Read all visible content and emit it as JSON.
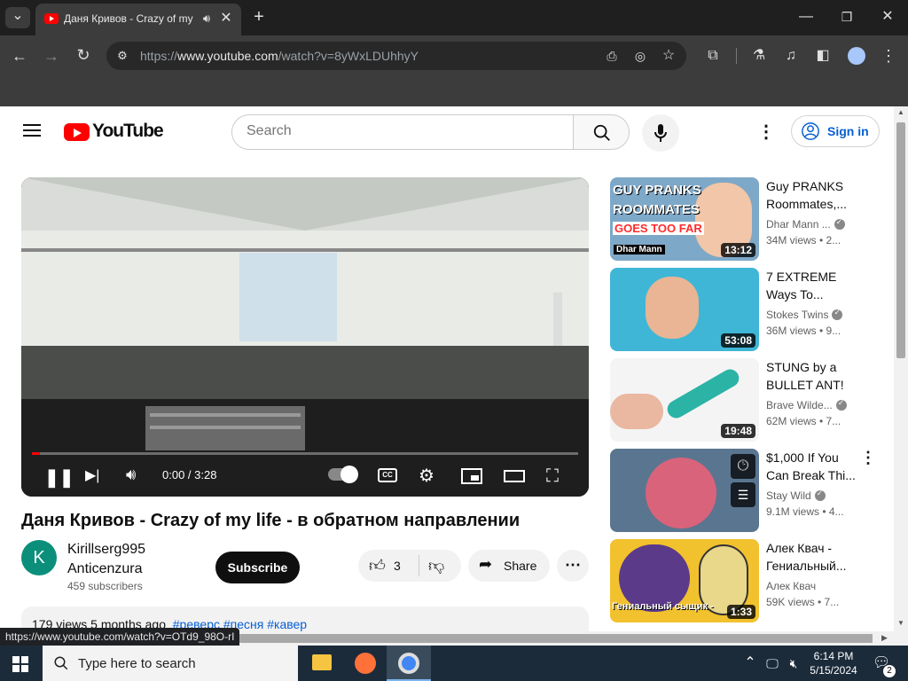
{
  "browser": {
    "tab_title": "Даня Кривов - Crazy of my",
    "url_prefix": "https://",
    "url_host": "www.youtube.com",
    "url_path": "/watch?v=8yWxLDUhhyY",
    "status_url": "https://www.youtube.com/watch?v=OTd9_98O-rI"
  },
  "header": {
    "logo_text": "YouTube",
    "search_placeholder": "Search",
    "sign_in": "Sign in"
  },
  "player": {
    "time": "0:00 / 3:28",
    "progress_fraction": 0.0
  },
  "video": {
    "title": "Даня Кривов - Crazy of my life - в обратном направлении",
    "channel_line1": "Kirillserg995",
    "channel_line2": "Anticenzura",
    "avatar_letter": "K",
    "subscribers": "459 subscribers",
    "subscribe_label": "Subscribe",
    "likes": "3",
    "share_label": "Share",
    "views_date": "179 views  5 months ago",
    "tags": "#реверс #песня #кавер"
  },
  "recommendations": [
    {
      "title": "Guy PRANKS Roommates,...",
      "channel": "Dhar Mann ...",
      "meta": "34M views • 2...",
      "duration": "13:12",
      "thumb_text1": "GUY PRANKS",
      "thumb_text2": "ROOMMATES",
      "thumb_text3": "GOES TOO FAR",
      "thumb_brand": "Dhar Mann"
    },
    {
      "title": "7 EXTREME Ways To...",
      "channel": "Stokes Twins",
      "meta": "36M views • 9...",
      "duration": "53:08"
    },
    {
      "title": "STUNG by a BULLET ANT!",
      "channel": "Brave Wilde...",
      "meta": "62M views • 7...",
      "duration": "19:48"
    },
    {
      "title": "$1,000 If You Can Break Thi...",
      "channel": "Stay Wild",
      "meta": "9.1M views • 4..."
    },
    {
      "title": "Алек Квач - Гениальный...",
      "channel": "Алек Квач",
      "meta": "59K views • 7...",
      "duration": "1:33",
      "thumb_caption": "Гениальный сыщик -"
    }
  ],
  "taskbar": {
    "search_placeholder": "Type here to search",
    "time": "6:14 PM",
    "date": "5/15/2024",
    "notification_count": "2"
  }
}
